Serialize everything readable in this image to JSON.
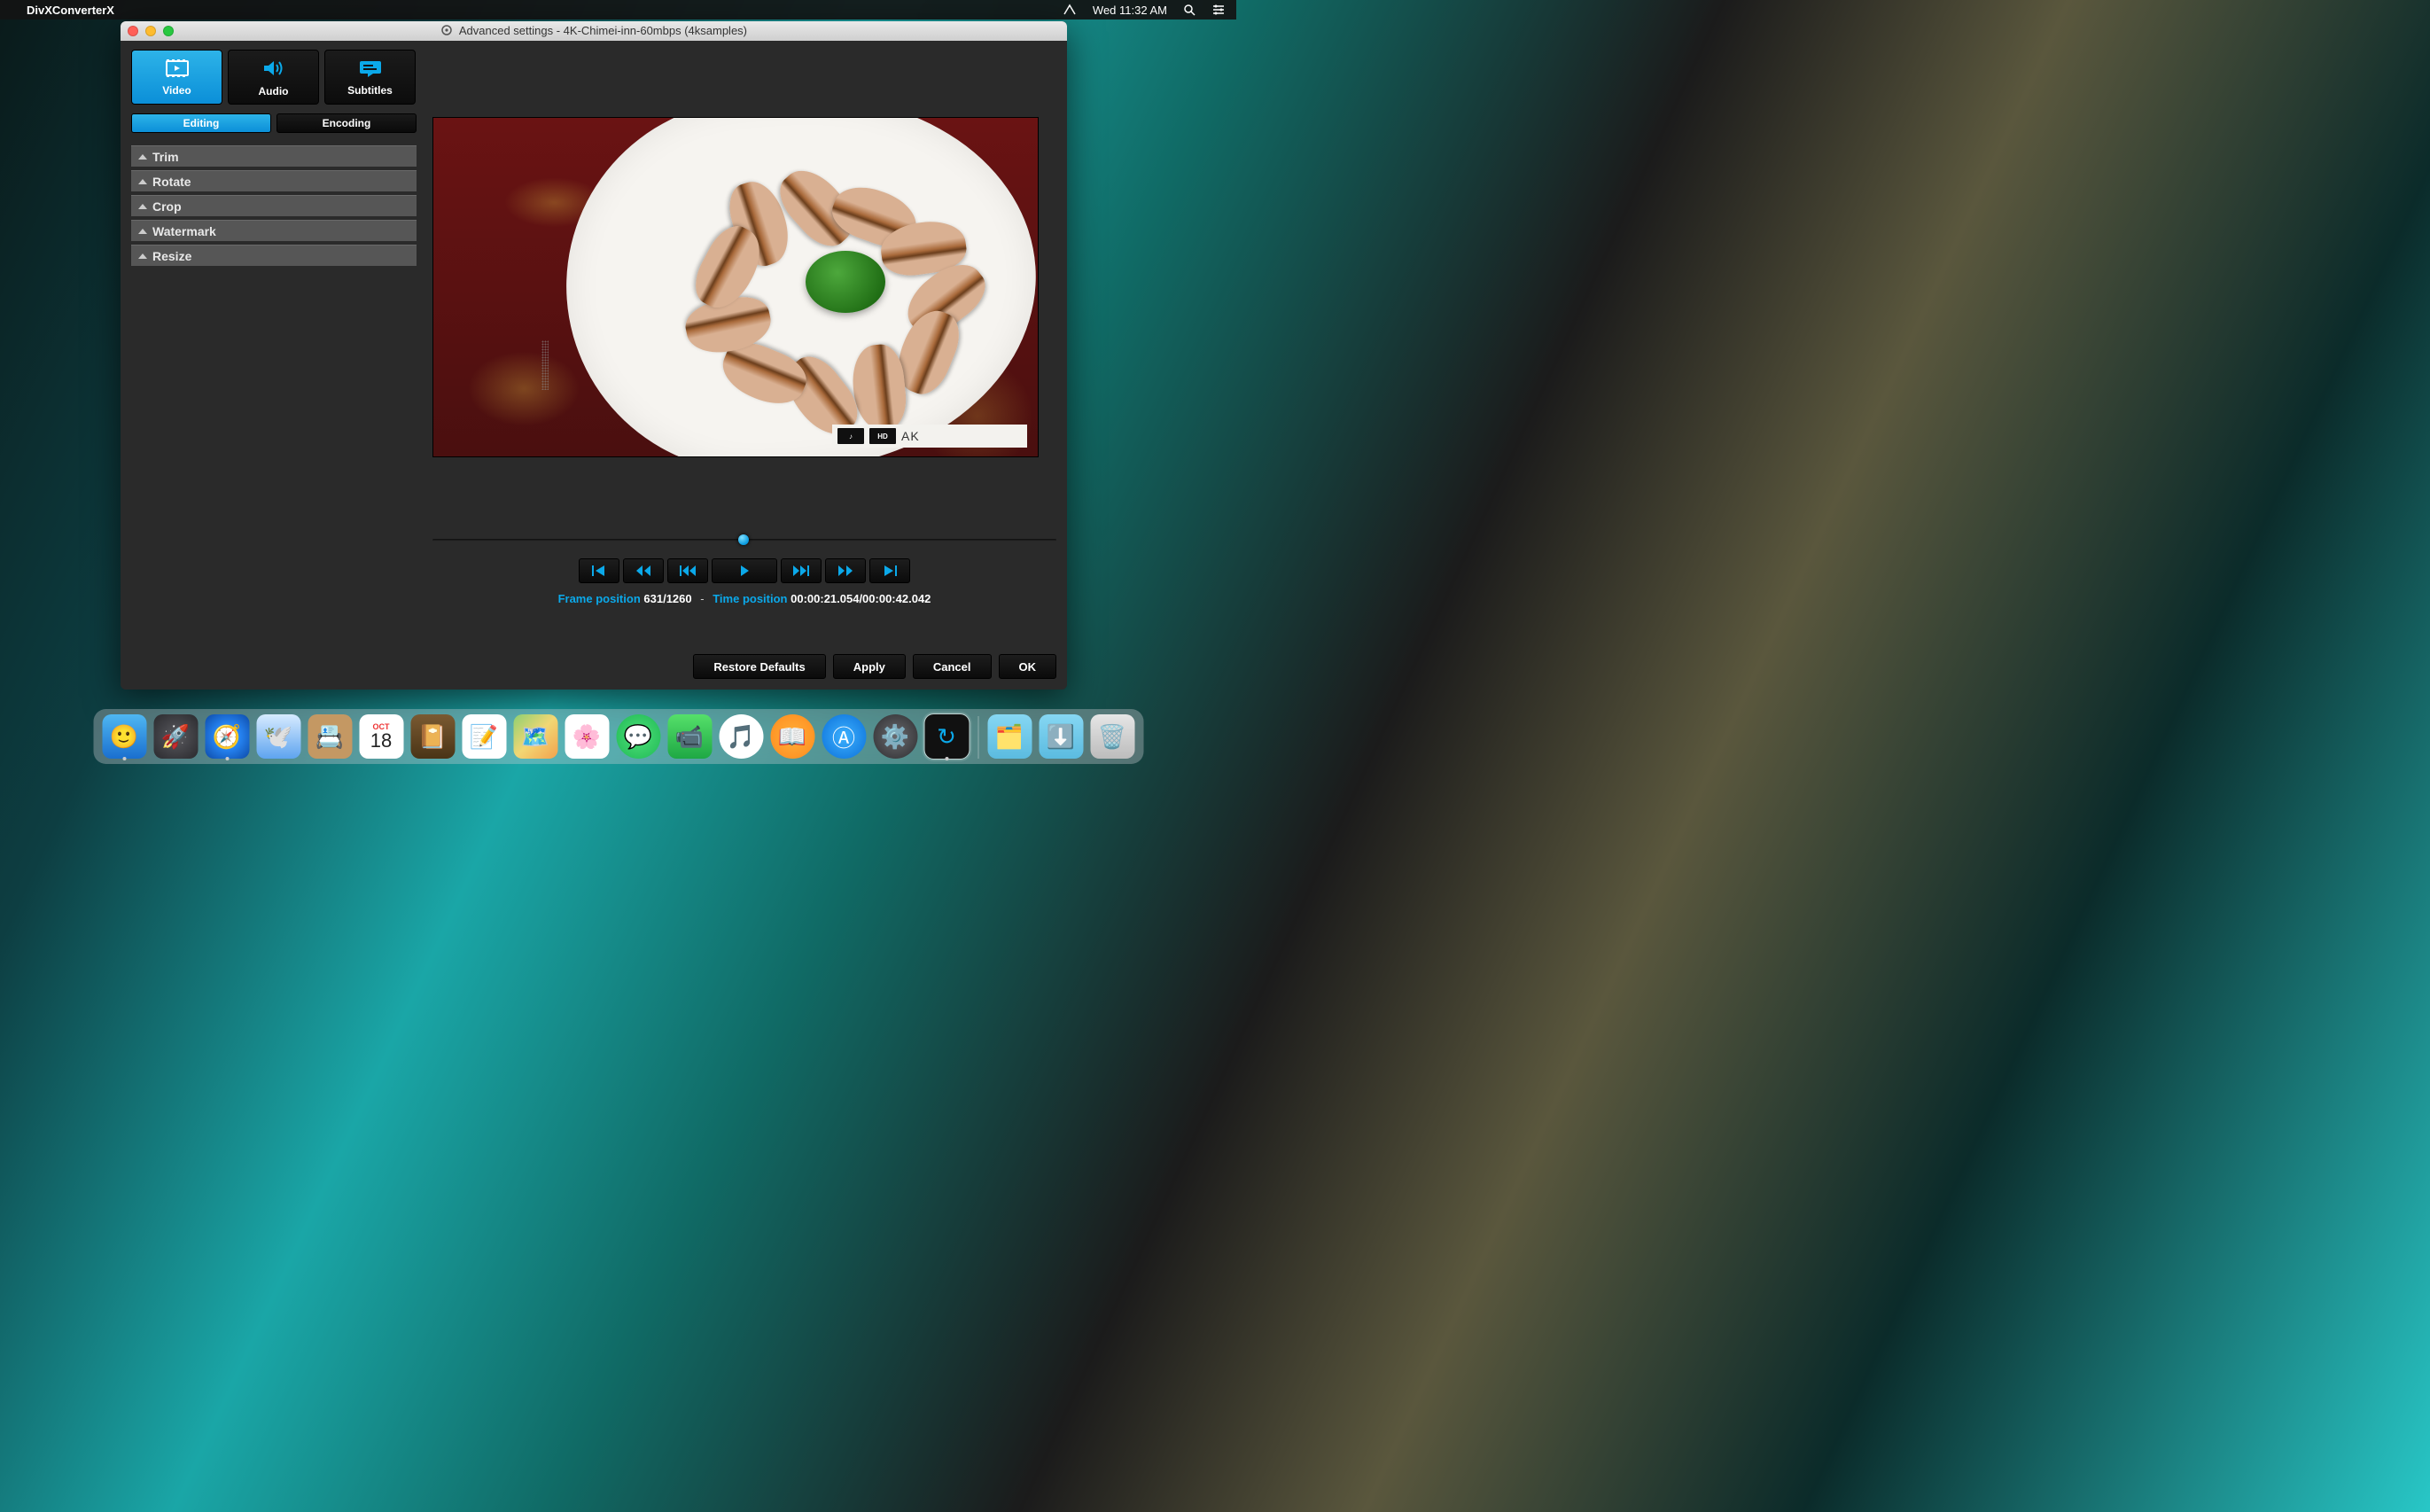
{
  "menubar": {
    "app_name": "DivXConverterX",
    "clock": "Wed 11:32 AM"
  },
  "window": {
    "title": "Advanced settings - 4K-Chimei-inn-60mbps (4ksamples)"
  },
  "bigtabs": {
    "video": "Video",
    "audio": "Audio",
    "subtitles": "Subtitles"
  },
  "subtabs": {
    "editing": "Editing",
    "encoding": "Encoding"
  },
  "accordion": {
    "trim": "Trim",
    "rotate": "Rotate",
    "crop": "Crop",
    "watermark": "Watermark",
    "resize": "Resize"
  },
  "readout": {
    "frame_label": "Frame position",
    "frame_value": "631/1260",
    "separator": "-",
    "time_label": "Time position",
    "time_value": "00:00:21.054/00:00:42.042"
  },
  "buttons": {
    "restore": "Restore Defaults",
    "apply": "Apply",
    "cancel": "Cancel",
    "ok": "OK"
  },
  "calendar": {
    "month": "OCT",
    "day": "18"
  },
  "preview_watermark": {
    "hd": "HD",
    "ak": "AK"
  }
}
